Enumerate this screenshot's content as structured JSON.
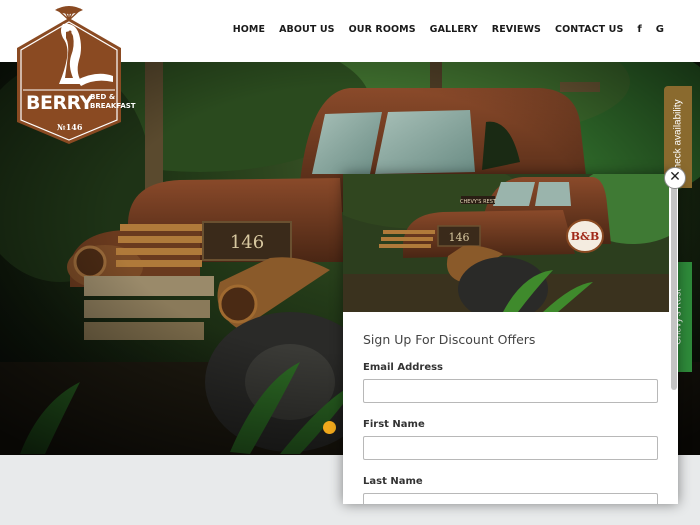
{
  "header": {
    "nav": [
      {
        "label": "HOME"
      },
      {
        "label": "ABOUT US"
      },
      {
        "label": "OUR ROOMS"
      },
      {
        "label": "GALLERY"
      },
      {
        "label": "REVIEWS"
      },
      {
        "label": "CONTACT US"
      }
    ],
    "social": [
      {
        "icon": "facebook-icon",
        "glyph": "f"
      },
      {
        "icon": "google-icon",
        "glyph": "G"
      }
    ]
  },
  "logo": {
    "name": "BERRY",
    "line1": "BED &",
    "line2": "BREAKFAST",
    "number": "№146",
    "color": "#8a4a22"
  },
  "hero": {
    "plate_text": "146",
    "active_slide": 1
  },
  "side_tabs": {
    "check": "Check availability",
    "chevys": "Chevy's Rest"
  },
  "popup": {
    "plate_text": "146",
    "sign_text": "B&B",
    "board_text": "CHEVY'S REST",
    "title": "Sign Up For Discount Offers",
    "fields": [
      {
        "label": "Email Address",
        "value": ""
      },
      {
        "label": "First Name",
        "value": ""
      },
      {
        "label": "Last Name",
        "value": ""
      }
    ],
    "close_glyph": "✕"
  },
  "colors": {
    "accent_orange": "#f0a81c",
    "tab_brown": "#8a6a2e",
    "tab_green": "#2e8a3a"
  }
}
